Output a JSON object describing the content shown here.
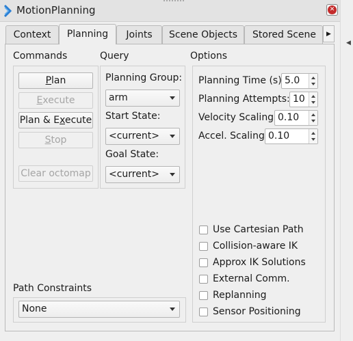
{
  "window": {
    "title": "MotionPlanning",
    "close_icon": "close-icon"
  },
  "tabs": [
    {
      "label": "Context"
    },
    {
      "label": "Planning",
      "active": true
    },
    {
      "label": "Joints"
    },
    {
      "label": "Scene Objects"
    },
    {
      "label": "Stored Scene"
    }
  ],
  "commands": {
    "label": "Commands",
    "plan_pre": "",
    "plan_u": "P",
    "plan_post": "lan",
    "execute_pre": "",
    "execute_u": "E",
    "execute_post": "xecute",
    "plan_execute_pre": "Plan & E",
    "plan_execute_u": "x",
    "plan_execute_post": "ecute",
    "stop_pre": "",
    "stop_u": "S",
    "stop_post": "top",
    "clear_octomap": "Clear octomap"
  },
  "query": {
    "label": "Query",
    "planning_group_label": "Planning Group:",
    "planning_group_value": "arm",
    "start_state_label": "Start State:",
    "start_state_value": "<current>",
    "goal_state_label": "Goal State:",
    "goal_state_value": "<current>"
  },
  "options": {
    "label": "Options",
    "planning_time_label": "Planning Time (s):",
    "planning_time_value": "5.0",
    "planning_attempts_label": "Planning Attempts:",
    "planning_attempts_value": "10",
    "velocity_scaling_label": "Velocity Scaling:",
    "velocity_scaling_value": "0.10",
    "accel_scaling_label": "Accel. Scaling:",
    "accel_scaling_value": "0.10",
    "checkboxes": [
      {
        "label": "Use Cartesian Path",
        "checked": false
      },
      {
        "label": "Collision-aware IK",
        "checked": false
      },
      {
        "label": "Approx IK Solutions",
        "checked": false
      },
      {
        "label": "External Comm.",
        "checked": false
      },
      {
        "label": "Replanning",
        "checked": false
      },
      {
        "label": "Sensor Positioning",
        "checked": false
      }
    ]
  },
  "path_constraints": {
    "label": "Path Constraints",
    "value": "None"
  }
}
